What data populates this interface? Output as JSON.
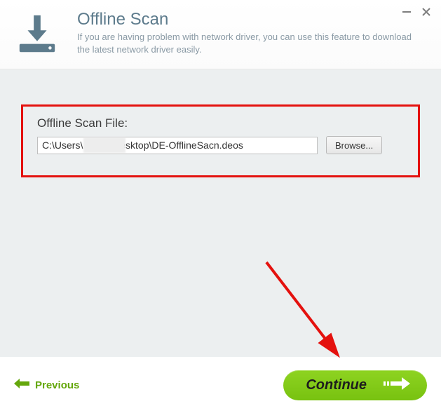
{
  "header": {
    "title": "Offline Scan",
    "subtitle": "If you are having problem with network driver, you can use this feature to download the latest network driver easily."
  },
  "content": {
    "file_label": "Offline Scan File:",
    "file_value": "C:\\Users\\          \\Desktop\\DE-OfflineSacn.deos",
    "browse_label": "Browse..."
  },
  "footer": {
    "previous_label": "Previous",
    "continue_label": "Continue"
  },
  "colors": {
    "accent_green": "#82c91e",
    "header_text": "#5d7b8c",
    "highlight_red": "#e4110e"
  }
}
